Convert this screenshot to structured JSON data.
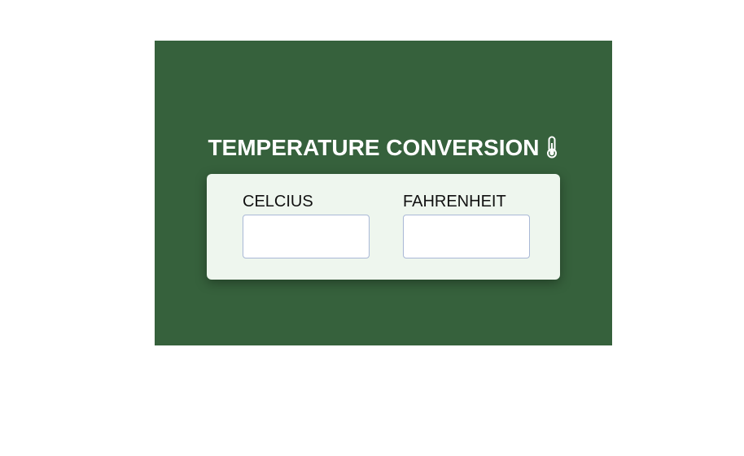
{
  "title": "TEMPERATURE CONVERSION",
  "title_icon": "thermometer-icon",
  "colors": {
    "panel_bg": "#36613c",
    "card_bg": "#eef6ee",
    "title_text": "#ffffff",
    "input_border": "#a9b8d6"
  },
  "fields": {
    "celcius": {
      "label": "CELCIUS",
      "value": "",
      "placeholder": ""
    },
    "fahrenheit": {
      "label": "FAHRENHEIT",
      "value": "",
      "placeholder": ""
    }
  }
}
